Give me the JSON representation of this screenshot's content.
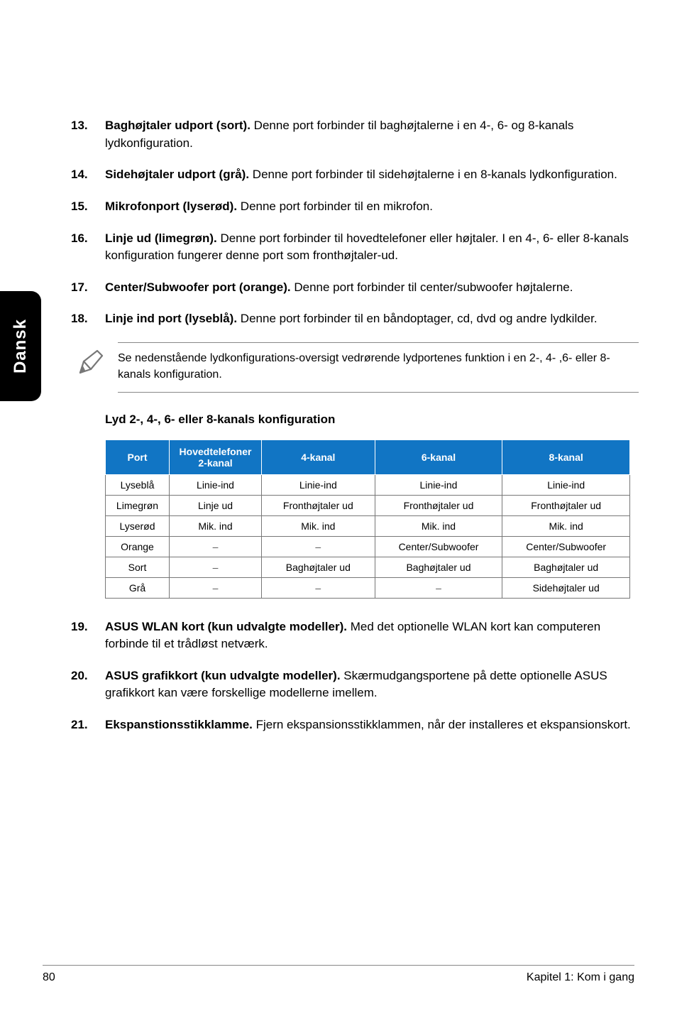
{
  "sideTab": "Dansk",
  "items_top": [
    {
      "num": "13.",
      "lead": "Baghøjtaler udport (sort).",
      "rest": " Denne port forbinder til baghøjtalerne i en 4-, 6- og 8-kanals lydkonfiguration."
    },
    {
      "num": "14.",
      "lead": "Sidehøjtaler udport (grå).",
      "rest": " Denne port forbinder til sidehøjtalerne i en 8-kanals lydkonfiguration."
    },
    {
      "num": "15.",
      "lead": "Mikrofonport (lyserød).",
      "rest": " Denne port forbinder til en mikrofon."
    },
    {
      "num": "16.",
      "lead": "Linje ud (limegrøn).",
      "rest": " Denne port forbinder til hovedtelefoner eller højtaler. I en 4-, 6- eller 8-kanals konfiguration fungerer denne port som fronthøjtaler-ud."
    },
    {
      "num": "17.",
      "lead": "Center/Subwoofer port (orange).",
      "rest": " Denne port forbinder til center/subwoofer højtalerne."
    },
    {
      "num": "18.",
      "lead": "Linje ind port (lyseblå).",
      "rest": " Denne port forbinder til en båndoptager, cd, dvd og andre lydkilder."
    }
  ],
  "note": "Se nedenstående lydkonfigurations-oversigt vedrørende lydportenes funktion i en 2-, 4- ,6- eller 8-kanals konfiguration.",
  "table_title": "Lyd 2-, 4-, 6- eller 8-kanals konfiguration",
  "headers": {
    "port": "Port",
    "k2a": "Hovedtelefoner",
    "k2b": "2-kanal",
    "k4": "4-kanal",
    "k6": "6-kanal",
    "k8": "8-kanal"
  },
  "rows": [
    {
      "port": "Lyseblå",
      "k2": "Linie-ind",
      "k4": "Linie-ind",
      "k6": "Linie-ind",
      "k8": "Linie-ind"
    },
    {
      "port": "Limegrøn",
      "k2": "Linje ud",
      "k4": "Fronthøjtaler ud",
      "k6": "Fronthøjtaler ud",
      "k8": "Fronthøjtaler ud"
    },
    {
      "port": "Lyserød",
      "k2": "Mik. ind",
      "k4": "Mik. ind",
      "k6": "Mik. ind",
      "k8": "Mik. ind"
    },
    {
      "port": "Orange",
      "k2": "–",
      "k4": "–",
      "k6": "Center/Subwoofer",
      "k8": "Center/Subwoofer"
    },
    {
      "port": "Sort",
      "k2": "–",
      "k4": "Baghøjtaler ud",
      "k6": "Baghøjtaler ud",
      "k8": "Baghøjtaler ud"
    },
    {
      "port": "Grå",
      "k2": "–",
      "k4": "–",
      "k6": "–",
      "k8": "Sidehøjtaler ud"
    }
  ],
  "items_bottom": [
    {
      "num": "19.",
      "lead": "ASUS WLAN kort (kun udvalgte modeller).",
      "rest": " Med det optionelle WLAN kort kan computeren forbinde til et trådløst netværk."
    },
    {
      "num": "20.",
      "lead": "ASUS grafikkort (kun udvalgte modeller).",
      "rest": " Skærmudgangsportene på dette optionelle ASUS grafikkort kan være forskellige modellerne imellem."
    },
    {
      "num": "21.",
      "lead": "Ekspanstionsstikklamme.",
      "rest": " Fjern ekspansionsstikklammen, når der installeres et ekspansionskort."
    }
  ],
  "footer": {
    "page": "80",
    "chapter": "Kapitel 1: Kom i gang"
  }
}
